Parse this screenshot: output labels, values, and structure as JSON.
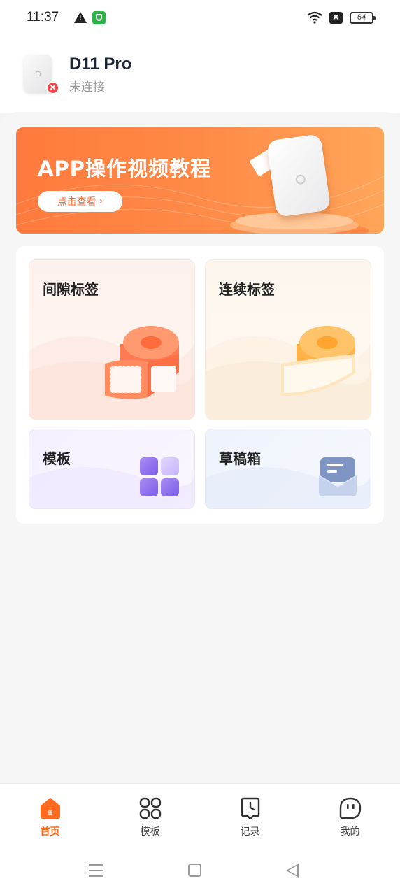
{
  "status_bar": {
    "time": "11:37",
    "battery": "64",
    "icons": [
      "warning-icon",
      "shield-icon",
      "wifi-icon",
      "no-sim-icon",
      "battery-icon"
    ]
  },
  "device": {
    "name": "D11 Pro",
    "status": "未连接"
  },
  "banner": {
    "title": "APP操作视频教程",
    "button_label": "点击查看",
    "button_chevron": "›"
  },
  "cards": {
    "gap_label": {
      "title": "间隙标签",
      "icon": "label-roll-icon"
    },
    "continuous_label": {
      "title": "连续标签",
      "icon": "label-roll-icon"
    },
    "templates": {
      "title": "模板",
      "icon": "grid-icon"
    },
    "drafts": {
      "title": "草稿箱",
      "icon": "inbox-icon"
    }
  },
  "bottom_nav": [
    {
      "label": "首页",
      "icon": "home-icon",
      "active": true
    },
    {
      "label": "模板",
      "icon": "grid-icon",
      "active": false
    },
    {
      "label": "记录",
      "icon": "record-icon",
      "active": false
    },
    {
      "label": "我的",
      "icon": "profile-icon",
      "active": false
    }
  ],
  "colors": {
    "accent": "#ff6a1f",
    "banner_start": "#ff7a3d",
    "banner_end": "#ffa65a",
    "disconnect": "#f0454a"
  }
}
